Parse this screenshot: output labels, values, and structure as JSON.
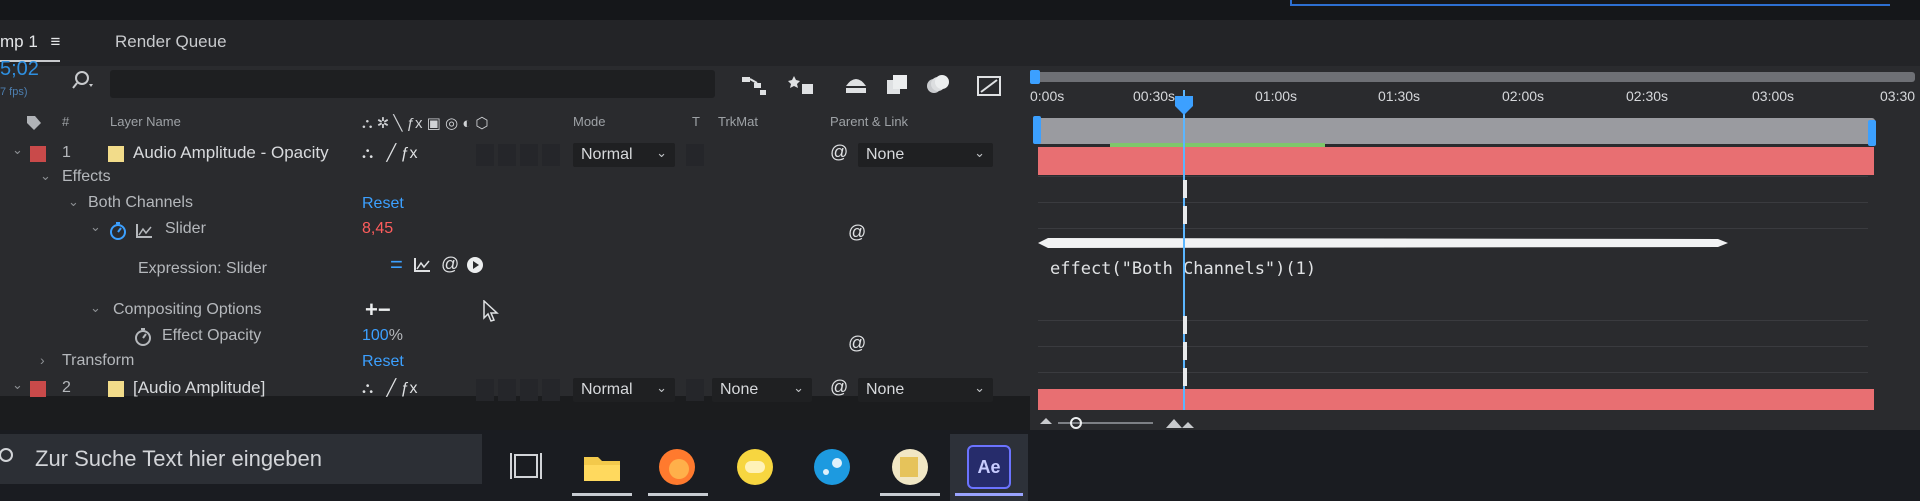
{
  "tabs": {
    "comp": "mp 1",
    "comp_menu": "≡",
    "render_queue": "Render Queue"
  },
  "timecode": {
    "value": "5;02",
    "fps": "7 fps)"
  },
  "columns": {
    "layer_num": "#",
    "layer_name": "Layer Name",
    "mode": "Mode",
    "t": "T",
    "trkmat": "TrkMat",
    "parent": "Parent & Link"
  },
  "layers": [
    {
      "num": "1",
      "name": "Audio Amplitude - Opacity",
      "mode": "Normal",
      "parent": "None"
    },
    {
      "num": "2",
      "name": "[Audio Amplitude]",
      "mode": "Normal",
      "trkmat": "None",
      "parent": "None"
    }
  ],
  "props": {
    "effects": "Effects",
    "both_channels": "Both Channels",
    "reset1": "Reset",
    "slider": "Slider",
    "slider_value": "8,45",
    "expression_slider": "Expression: Slider",
    "compositing": "Compositing Options",
    "compositing_ctrl": "+−",
    "effect_opacity": "Effect Opacity",
    "opacity_value": "100",
    "opacity_unit": "%",
    "transform": "Transform",
    "reset2": "Reset"
  },
  "ruler": [
    "0:00s",
    "00:30s",
    "01:00s",
    "01:30s",
    "02:00s",
    "02:30s",
    "03:00s",
    "03:30"
  ],
  "expression_text": "effect(\"Both Channels\")(1)",
  "taskbar": {
    "search_placeholder": "Zur Suche Text hier eingeben",
    "ae_label": "Ae"
  },
  "colors": {
    "accent_blue": "#3ca0ff",
    "layer_bar": "#e86f72",
    "value_red": "#ff5d5d"
  },
  "icons": [
    "search-icon",
    "solo-icon",
    "shy-icon",
    "motion-blur-icon",
    "graph-editor-icon",
    "stopwatch-icon",
    "pickwhip-icon",
    "task-view-icon",
    "file-explorer-icon",
    "firefox-icon",
    "steam-icon",
    "after-effects-icon"
  ]
}
